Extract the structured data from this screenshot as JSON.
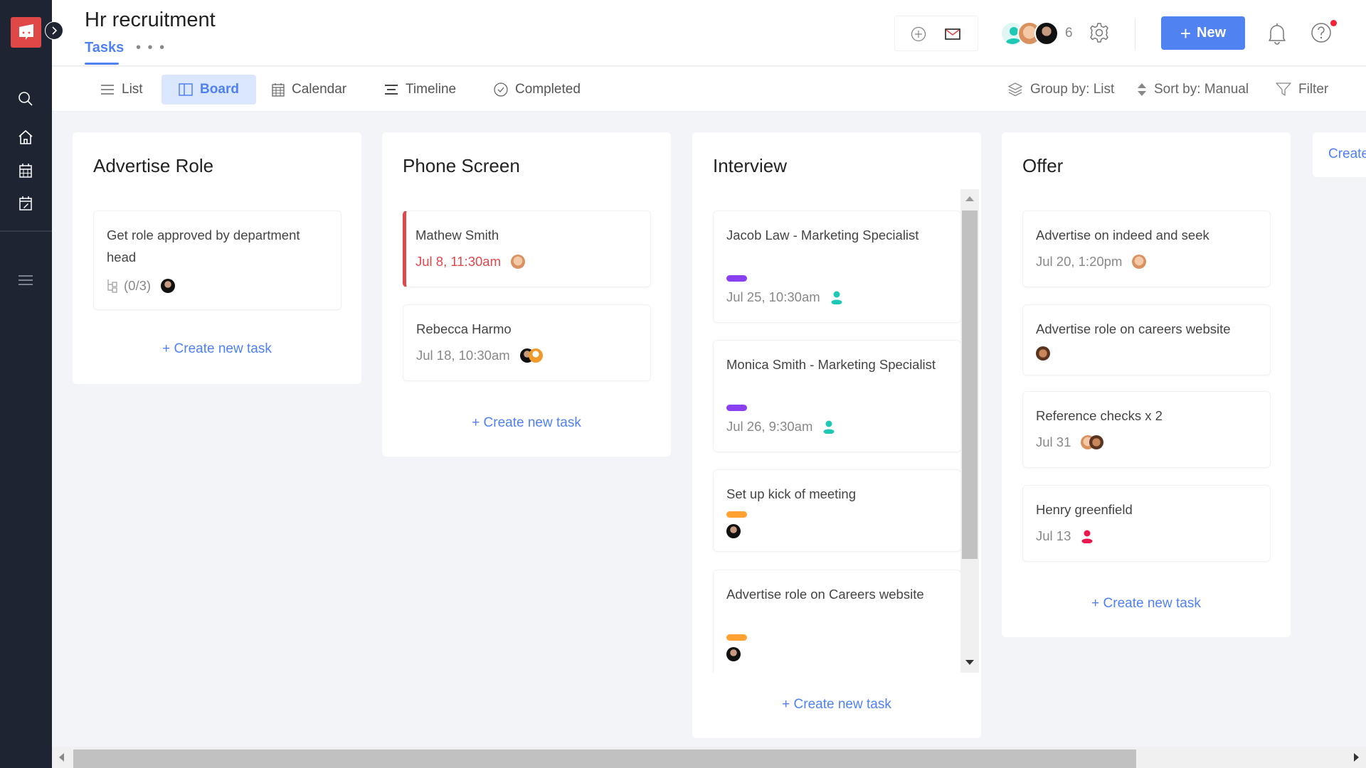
{
  "app": {
    "title": "Hr recruitment",
    "tabs": [
      {
        "label": "Tasks",
        "active": true
      }
    ],
    "more_label": "• • •"
  },
  "header": {
    "member_count": "6",
    "new_button_label": "New",
    "accent_color": "#5082f2",
    "notification_dot_color": "#ee2233"
  },
  "toolbar": {
    "views": [
      {
        "label": "List",
        "icon": "list-icon"
      },
      {
        "label": "Board",
        "icon": "board-icon",
        "active": true
      },
      {
        "label": "Calendar",
        "icon": "calendar-icon"
      },
      {
        "label": "Timeline",
        "icon": "timeline-icon"
      },
      {
        "label": "Completed",
        "icon": "check-circle-icon"
      }
    ],
    "group_by": "Group by: List",
    "sort_by": "Sort by: Manual",
    "filter": "Filter"
  },
  "board": {
    "create_task_label": "+ Create new task",
    "create_column_label": "Create",
    "columns": [
      {
        "title": "Advertise Role",
        "cards": [
          {
            "title": "Get role approved by department head",
            "subtasks": "(0/3)"
          }
        ]
      },
      {
        "title": "Phone Screen",
        "cards": [
          {
            "title": "Mathew Smith",
            "date": "Jul 8, 11:30am",
            "overdue": true
          },
          {
            "title": "Rebecca Harmo",
            "date": "Jul 18, 10:30am"
          }
        ]
      },
      {
        "title": "Interview",
        "cards": [
          {
            "title": "Jacob Law - Marketing Specialist",
            "tag_color": "#8a3ff0",
            "date": "Jul 25, 10:30am"
          },
          {
            "title": "Monica Smith - Marketing Specialist",
            "tag_color": "#8a3ff0",
            "date": "Jul 26, 9:30am"
          },
          {
            "title": "Set up kick of meeting",
            "tag_color": "#ffa133"
          },
          {
            "title": "Advertise role on Careers website",
            "tag_color": "#ffa133"
          }
        ]
      },
      {
        "title": "Offer",
        "cards": [
          {
            "title": "Advertise on indeed and seek",
            "date": "Jul 20, 1:20pm"
          },
          {
            "title": "Advertise role on careers website"
          },
          {
            "title": "Reference checks x 2",
            "date": "Jul 31"
          },
          {
            "title": "Henry greenfield",
            "date": "Jul 13"
          }
        ]
      }
    ]
  }
}
